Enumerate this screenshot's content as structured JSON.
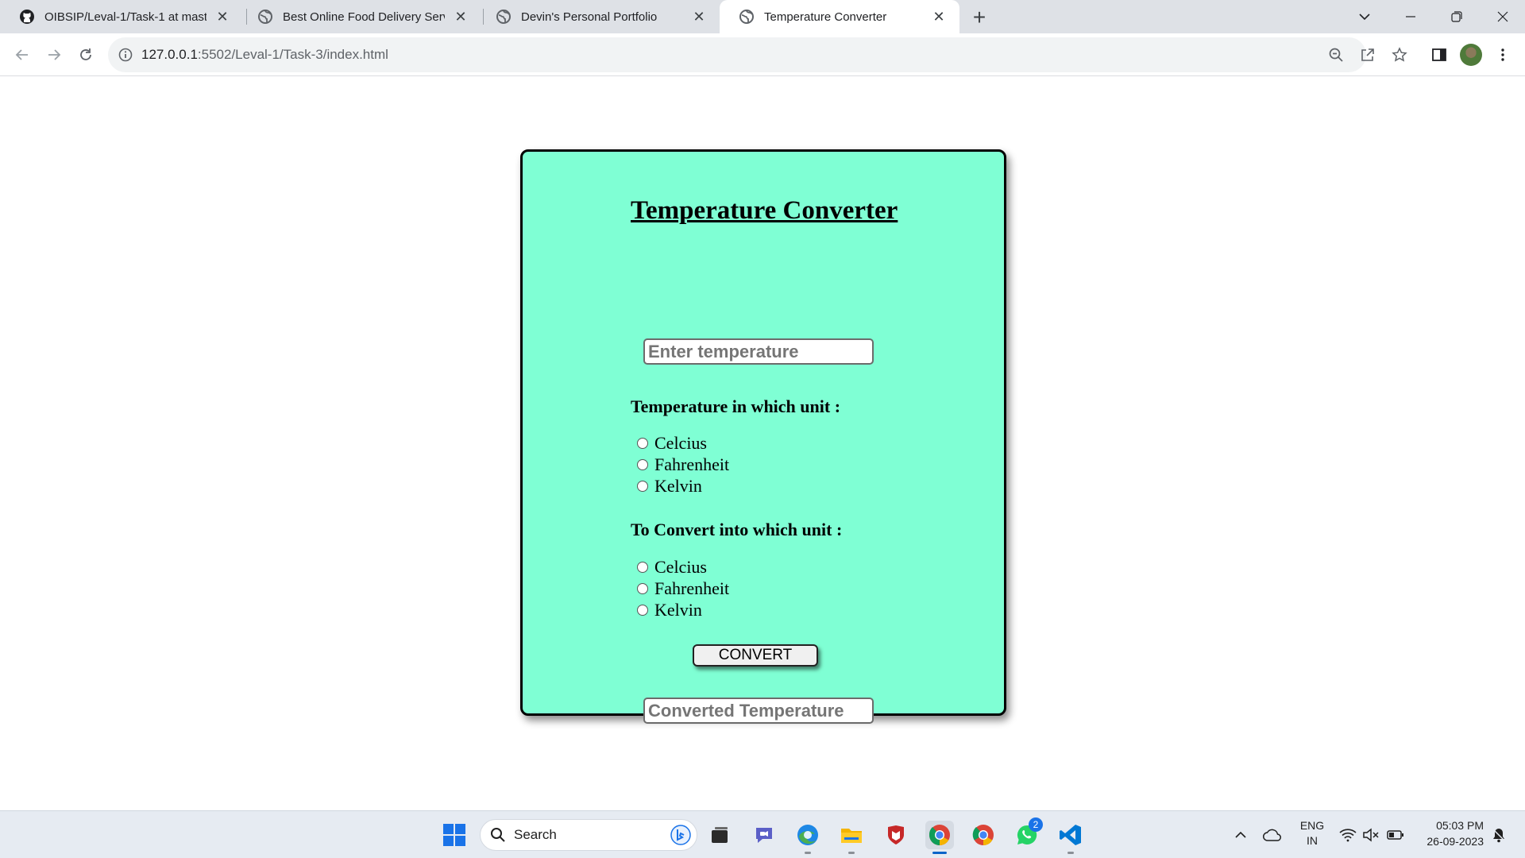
{
  "browser": {
    "tabs": [
      {
        "title": "OIBSIP/Leval-1/Task-1 at master",
        "favicon": "github-icon",
        "active": false
      },
      {
        "title": "Best Online Food Delivery Servic",
        "favicon": "globe-icon",
        "active": false
      },
      {
        "title": "Devin's Personal Portfolio",
        "favicon": "globe-icon",
        "active": false
      },
      {
        "title": "Temperature Converter",
        "favicon": "globe-icon",
        "active": true
      }
    ],
    "url_host": "127.0.0.1",
    "url_rest": ":5502/Leval-1/Task-3/index.html"
  },
  "page": {
    "title": "Temperature Converter",
    "input_placeholder": "Enter temperature",
    "from_label": "Temperature in which unit :",
    "from_units": [
      "Celcius",
      "Fahrenheit",
      "Kelvin"
    ],
    "to_label": "To Convert into which unit :",
    "to_units": [
      "Celcius",
      "Fahrenheit",
      "Kelvin"
    ],
    "convert_label": "CONVERT",
    "output_placeholder": "Converted Temperature"
  },
  "taskbar": {
    "search_label": "Search",
    "whatsapp_badge": "2",
    "lang_top": "ENG",
    "lang_bottom": "IN",
    "time": "05:03 PM",
    "date": "26-09-2023"
  },
  "colors": {
    "card_bg": "#7fffd4",
    "taskbar_accent": "#0a64c8"
  }
}
